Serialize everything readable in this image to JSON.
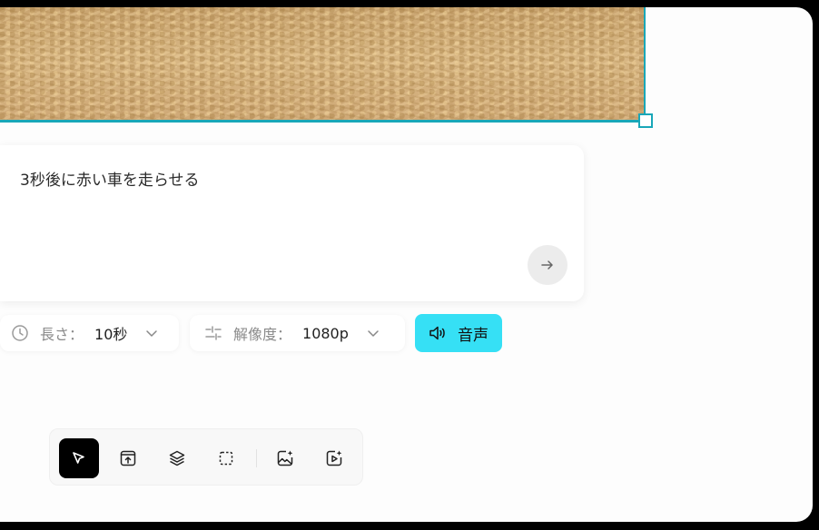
{
  "prompt": {
    "text": "3秒後に赤い車を走らせる"
  },
  "options": {
    "duration": {
      "label": "長さ：",
      "value": "10秒"
    },
    "resolution": {
      "label": "解像度：",
      "value": "1080p"
    },
    "audio": {
      "label": "音声"
    }
  },
  "toolbar": {
    "tools": [
      {
        "icon": "select-pointer-icon",
        "active": true
      },
      {
        "icon": "upload-icon",
        "active": false
      },
      {
        "icon": "layers-icon",
        "active": false
      },
      {
        "icon": "marquee-select-icon",
        "active": false
      },
      {
        "icon": "generate-image-icon",
        "active": false
      },
      {
        "icon": "generate-video-icon",
        "active": false
      }
    ]
  },
  "colors": {
    "accent": "#36e0f5",
    "selection": "#19a7b8"
  }
}
